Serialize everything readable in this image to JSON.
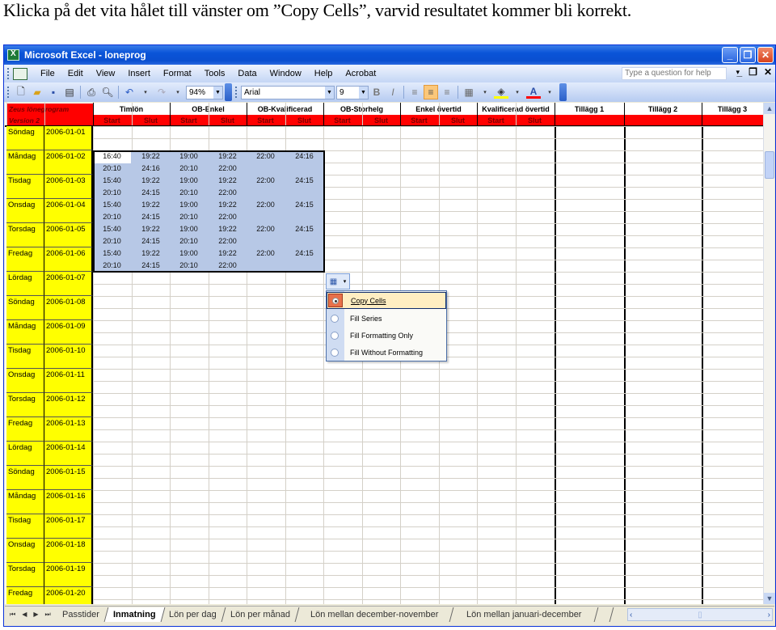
{
  "caption": "Klicka på det vita hålet till vänster om ”Copy Cells”, varvid resultatet kommer bli korrekt.",
  "window": {
    "title": "Microsoft Excel - loneprog",
    "buttons": [
      "minimize",
      "restore",
      "close"
    ]
  },
  "menu": {
    "items": [
      "File",
      "Edit",
      "View",
      "Insert",
      "Format",
      "Tools",
      "Data",
      "Window",
      "Help",
      "Acrobat"
    ],
    "help_placeholder": "Type a question for help"
  },
  "toolbar": {
    "zoom": "94%",
    "font": "Arial",
    "font_size": "9",
    "icons": [
      "new-icon",
      "open-icon",
      "save-icon",
      "permission-icon",
      "print-icon",
      "print-preview-icon",
      "undo-icon",
      "redo-icon"
    ],
    "format_icons": [
      "bold-icon",
      "italic-icon",
      "align-left-icon",
      "align-center-icon",
      "align-right-icon",
      "borders-icon",
      "fill-color-icon",
      "font-color-icon"
    ],
    "colors": {
      "fill": "#ffff00",
      "font": "#ff0000",
      "active": "#fbc77a"
    }
  },
  "sheet": {
    "header": {
      "app_name": "Zeus lönegrogram",
      "version": "Version 2",
      "groups": [
        "Timlön",
        "OB-Enkel",
        "OB-Kvalificerad",
        "OB-Storhelg",
        "Enkel övertid",
        "Kvalificerad övertid"
      ],
      "sub_start": "Start",
      "sub_end": "Slut",
      "extras": [
        "Tillägg 1",
        "Tillägg 2",
        "Tillägg 3"
      ]
    },
    "days": [
      {
        "name": "Söndag",
        "date": "2006-01-01"
      },
      {
        "name": "Måndag",
        "date": "2006-01-02"
      },
      {
        "name": "Tisdag",
        "date": "2006-01-03"
      },
      {
        "name": "Onsdag",
        "date": "2006-01-04"
      },
      {
        "name": "Torsdag",
        "date": "2006-01-05"
      },
      {
        "name": "Fredag",
        "date": "2006-01-06"
      },
      {
        "name": "Lördag",
        "date": "2006-01-07"
      },
      {
        "name": "Söndag",
        "date": "2006-01-08"
      },
      {
        "name": "Måndag",
        "date": "2006-01-09"
      },
      {
        "name": "Tisdag",
        "date": "2006-01-10"
      },
      {
        "name": "Onsdag",
        "date": "2006-01-11"
      },
      {
        "name": "Torsdag",
        "date": "2006-01-12"
      },
      {
        "name": "Fredag",
        "date": "2006-01-13"
      },
      {
        "name": "Lördag",
        "date": "2006-01-14"
      },
      {
        "name": "Söndag",
        "date": "2006-01-15"
      },
      {
        "name": "Måndag",
        "date": "2006-01-16"
      },
      {
        "name": "Tisdag",
        "date": "2006-01-17"
      },
      {
        "name": "Onsdag",
        "date": "2006-01-18"
      },
      {
        "name": "Torsdag",
        "date": "2006-01-19"
      },
      {
        "name": "Fredag",
        "date": "2006-01-20"
      }
    ],
    "time_rows": [
      [
        "16:40",
        "19:22",
        "19:00",
        "19:22",
        "22:00",
        "24:16"
      ],
      [
        "20:10",
        "24:16",
        "20:10",
        "22:00",
        "",
        ""
      ],
      [
        "15:40",
        "19:22",
        "19:00",
        "19:22",
        "22:00",
        "24:15"
      ],
      [
        "20:10",
        "24:15",
        "20:10",
        "22:00",
        "",
        ""
      ],
      [
        "15:40",
        "19:22",
        "19:00",
        "19:22",
        "22:00",
        "24:15"
      ],
      [
        "20:10",
        "24:15",
        "20:10",
        "22:00",
        "",
        ""
      ],
      [
        "15:40",
        "19:22",
        "19:00",
        "19:22",
        "22:00",
        "24:15"
      ],
      [
        "20:10",
        "24:15",
        "20:10",
        "22:00",
        "",
        ""
      ],
      [
        "15:40",
        "19:22",
        "19:00",
        "19:22",
        "22:00",
        "24:15"
      ],
      [
        "20:10",
        "24:15",
        "20:10",
        "22:00",
        "",
        ""
      ]
    ],
    "colors": {
      "header_red": "#ff0000",
      "day_yellow": "#ffff00",
      "selection": "#b7c8e6"
    }
  },
  "autofill": {
    "options": [
      {
        "label": "Copy Cells",
        "selected": true
      },
      {
        "label": "Fill Series",
        "selected": false
      },
      {
        "label": "Fill Formatting Only",
        "selected": false
      },
      {
        "label": "Fill Without Formatting",
        "selected": false
      }
    ]
  },
  "tabs": {
    "items": [
      "Passtider",
      "Inmatning",
      "Lön per dag",
      "Lön per månad",
      "Lön mellan december-november",
      "Lön mellan januari-december"
    ],
    "active_index": 1
  }
}
